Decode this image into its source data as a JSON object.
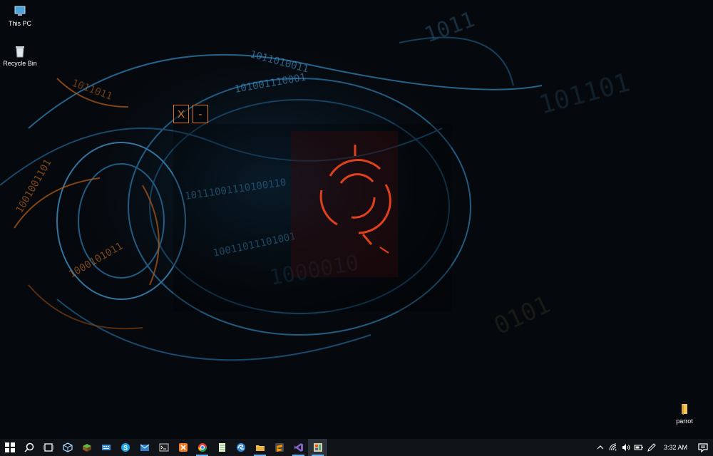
{
  "desktop": {
    "icons": [
      {
        "label": "This PC",
        "icon": "this-pc-icon"
      },
      {
        "label": "Recycle Bin",
        "icon": "recycle-bin-icon"
      },
      {
        "label": "parrot",
        "icon": "folder-icon"
      }
    ]
  },
  "overlay": {
    "close_label": "X",
    "minimize_label": "-",
    "accent_color": "#e07a24",
    "ring_color": "#e0401c"
  },
  "taskbar": {
    "items": [
      {
        "icon": "start-icon"
      },
      {
        "icon": "search-icon"
      },
      {
        "icon": "task-view-icon"
      },
      {
        "icon": "3d-builder-icon"
      },
      {
        "icon": "minecraft-icon"
      },
      {
        "icon": "keyboard-icon"
      },
      {
        "icon": "skype-icon"
      },
      {
        "icon": "mail-icon"
      },
      {
        "icon": "command-prompt-icon"
      },
      {
        "icon": "xampp-icon"
      },
      {
        "icon": "chrome-icon"
      },
      {
        "icon": "notepad-icon"
      },
      {
        "icon": "edge-icon"
      },
      {
        "icon": "file-explorer-icon"
      },
      {
        "icon": "sublime-text-icon"
      },
      {
        "icon": "visual-studio-icon"
      },
      {
        "icon": "app-window-icon"
      }
    ],
    "tray": {
      "icons": [
        "chevron-up-icon",
        "wifi-icon",
        "volume-icon",
        "battery-icon",
        "pen-icon"
      ],
      "time": "3:32 AM",
      "notification_icon": "notification-icon"
    }
  }
}
